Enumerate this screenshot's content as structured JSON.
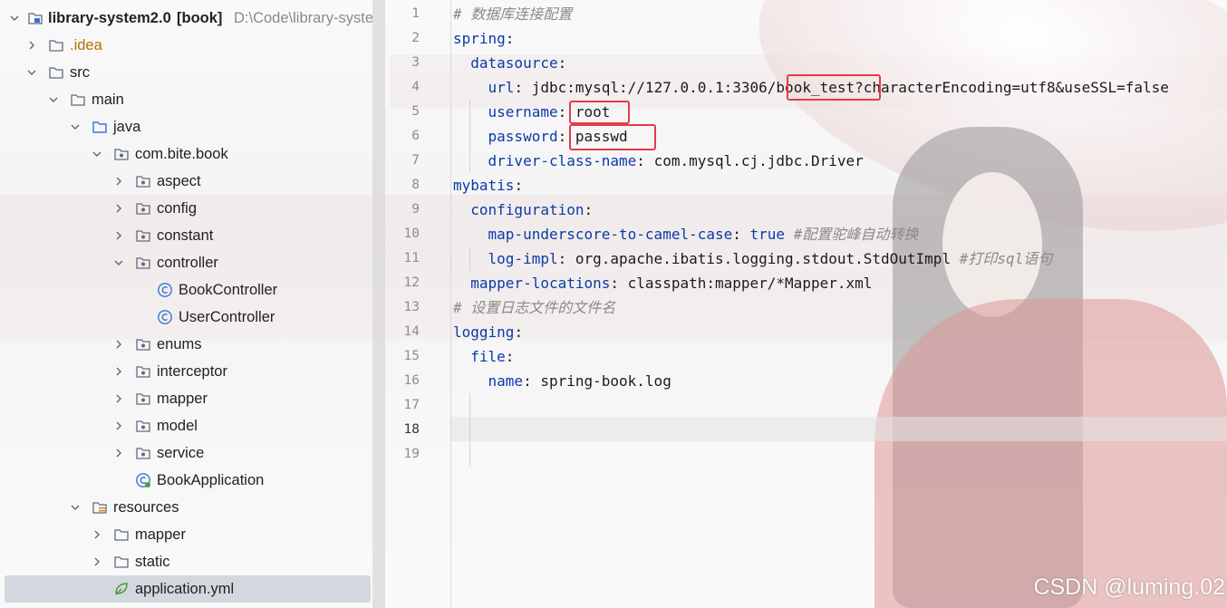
{
  "project_tree": {
    "root": {
      "name": "library-system2.0",
      "module": "[book]",
      "path": "D:\\Code\\library-syster"
    },
    "items": [
      {
        "label": ".idea"
      },
      {
        "label": "src"
      },
      {
        "label": "main"
      },
      {
        "label": "java"
      },
      {
        "label": "com.bite.book"
      },
      {
        "label": "aspect"
      },
      {
        "label": "config"
      },
      {
        "label": "constant"
      },
      {
        "label": "controller"
      },
      {
        "label": "BookController"
      },
      {
        "label": "UserController"
      },
      {
        "label": "enums"
      },
      {
        "label": "interceptor"
      },
      {
        "label": "mapper"
      },
      {
        "label": "model"
      },
      {
        "label": "service"
      },
      {
        "label": "BookApplication"
      },
      {
        "label": "resources"
      },
      {
        "label": "mapper"
      },
      {
        "label": "static"
      },
      {
        "label": "application.yml"
      }
    ]
  },
  "editor": {
    "line_numbers": [
      "1",
      "2",
      "3",
      "4",
      "5",
      "6",
      "7",
      "8",
      "9",
      "10",
      "11",
      "12",
      "13",
      "14",
      "15",
      "16",
      "17",
      "18",
      "19"
    ],
    "current_line": "18",
    "lines": {
      "l1": "# 数据库连接配置",
      "l2_key": "spring",
      "l3_key": "datasource",
      "l4_key": "url",
      "l4_val_a": "jdbc:mysql://127.0.0.1:3306/",
      "l4_val_b": "book_test?",
      "l4_val_c": "characterEncoding=utf8&useSSL=false",
      "l5_key": "username",
      "l5_val": "root",
      "l6_key": "password",
      "l6_val": "passwd",
      "l7_key": "driver-class-name",
      "l7_val": "com.mysql.cj.jdbc.Driver",
      "l8_key": "mybatis",
      "l9_key": "configuration",
      "l10_key": "map-underscore-to-camel-case",
      "l10_val": "true",
      "l10_comment": "#配置驼峰自动转换",
      "l11_key": "log-impl",
      "l11_val": "org.apache.ibatis.logging.stdout.StdOutImpl",
      "l11_comment": "#打印sql语句",
      "l12_key": "mapper-locations",
      "l12_val": "classpath:mapper/*Mapper.xml",
      "l13": "# 设置日志文件的文件名",
      "l14_key": "logging",
      "l15_key": "file",
      "l16_key": "name",
      "l16_val": "spring-book.log"
    }
  },
  "watermark": "CSDN @luming.02",
  "colors": {
    "key": "#0b3aa8",
    "comment": "#8a8a8a",
    "highlight_box": "#e23b4a",
    "selection": "#cdd2da"
  }
}
